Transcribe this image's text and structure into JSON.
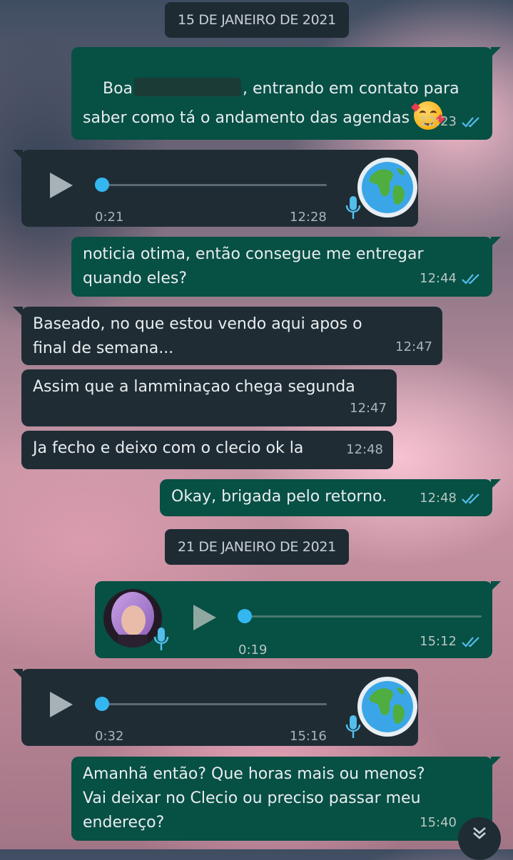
{
  "dates": [
    "15 DE JANEIRO DE 2021",
    "21 DE JANEIRO DE 2021"
  ],
  "messages": [
    {
      "dir": "out",
      "text_before": "Boa",
      "text_after": ", entrando em contato para\nsaber como tá o andamento das agendas",
      "time": "12:23"
    },
    {
      "dir": "in",
      "type": "audio",
      "duration": "0:21",
      "time": "12:28",
      "progress": 0.0
    },
    {
      "dir": "out",
      "text": "noticia otima, então consegue me entregar\nquando eles?",
      "time": "12:44"
    },
    {
      "dir": "in",
      "text": "Baseado, no que estou vendo aqui apos o\nfinal de semana...",
      "time": "12:47"
    },
    {
      "dir": "in",
      "text": "Assim que a lamminaçao chega segunda",
      "time": "12:47"
    },
    {
      "dir": "in",
      "text": "Ja fecho e deixo com o clecio ok la",
      "time": "12:48"
    },
    {
      "dir": "out",
      "text": "Okay, brigada pelo retorno.",
      "time": "12:48"
    },
    {
      "dir": "out",
      "type": "audio",
      "duration": "0:19",
      "time": "15:12",
      "progress": 0.0
    },
    {
      "dir": "in",
      "type": "audio",
      "duration": "0:32",
      "time": "15:16",
      "progress": 0.0
    },
    {
      "dir": "out",
      "text": "Amanhã então? Que horas mais ou menos?\nVai deixar no Clecio ou preciso passar meu\nendereço?",
      "time": "15:40"
    }
  ],
  "colors": {
    "outgoing": "#075044",
    "incoming": "#1f2c34",
    "read_ticks": "#53bdeb",
    "audio_knob": "#34b7f1"
  },
  "icons": [
    "play-icon",
    "mic-icon",
    "read-ticks-icon",
    "globe-avatar",
    "scroll-down-icon",
    "smiling-face-with-hearts-emoji"
  ]
}
